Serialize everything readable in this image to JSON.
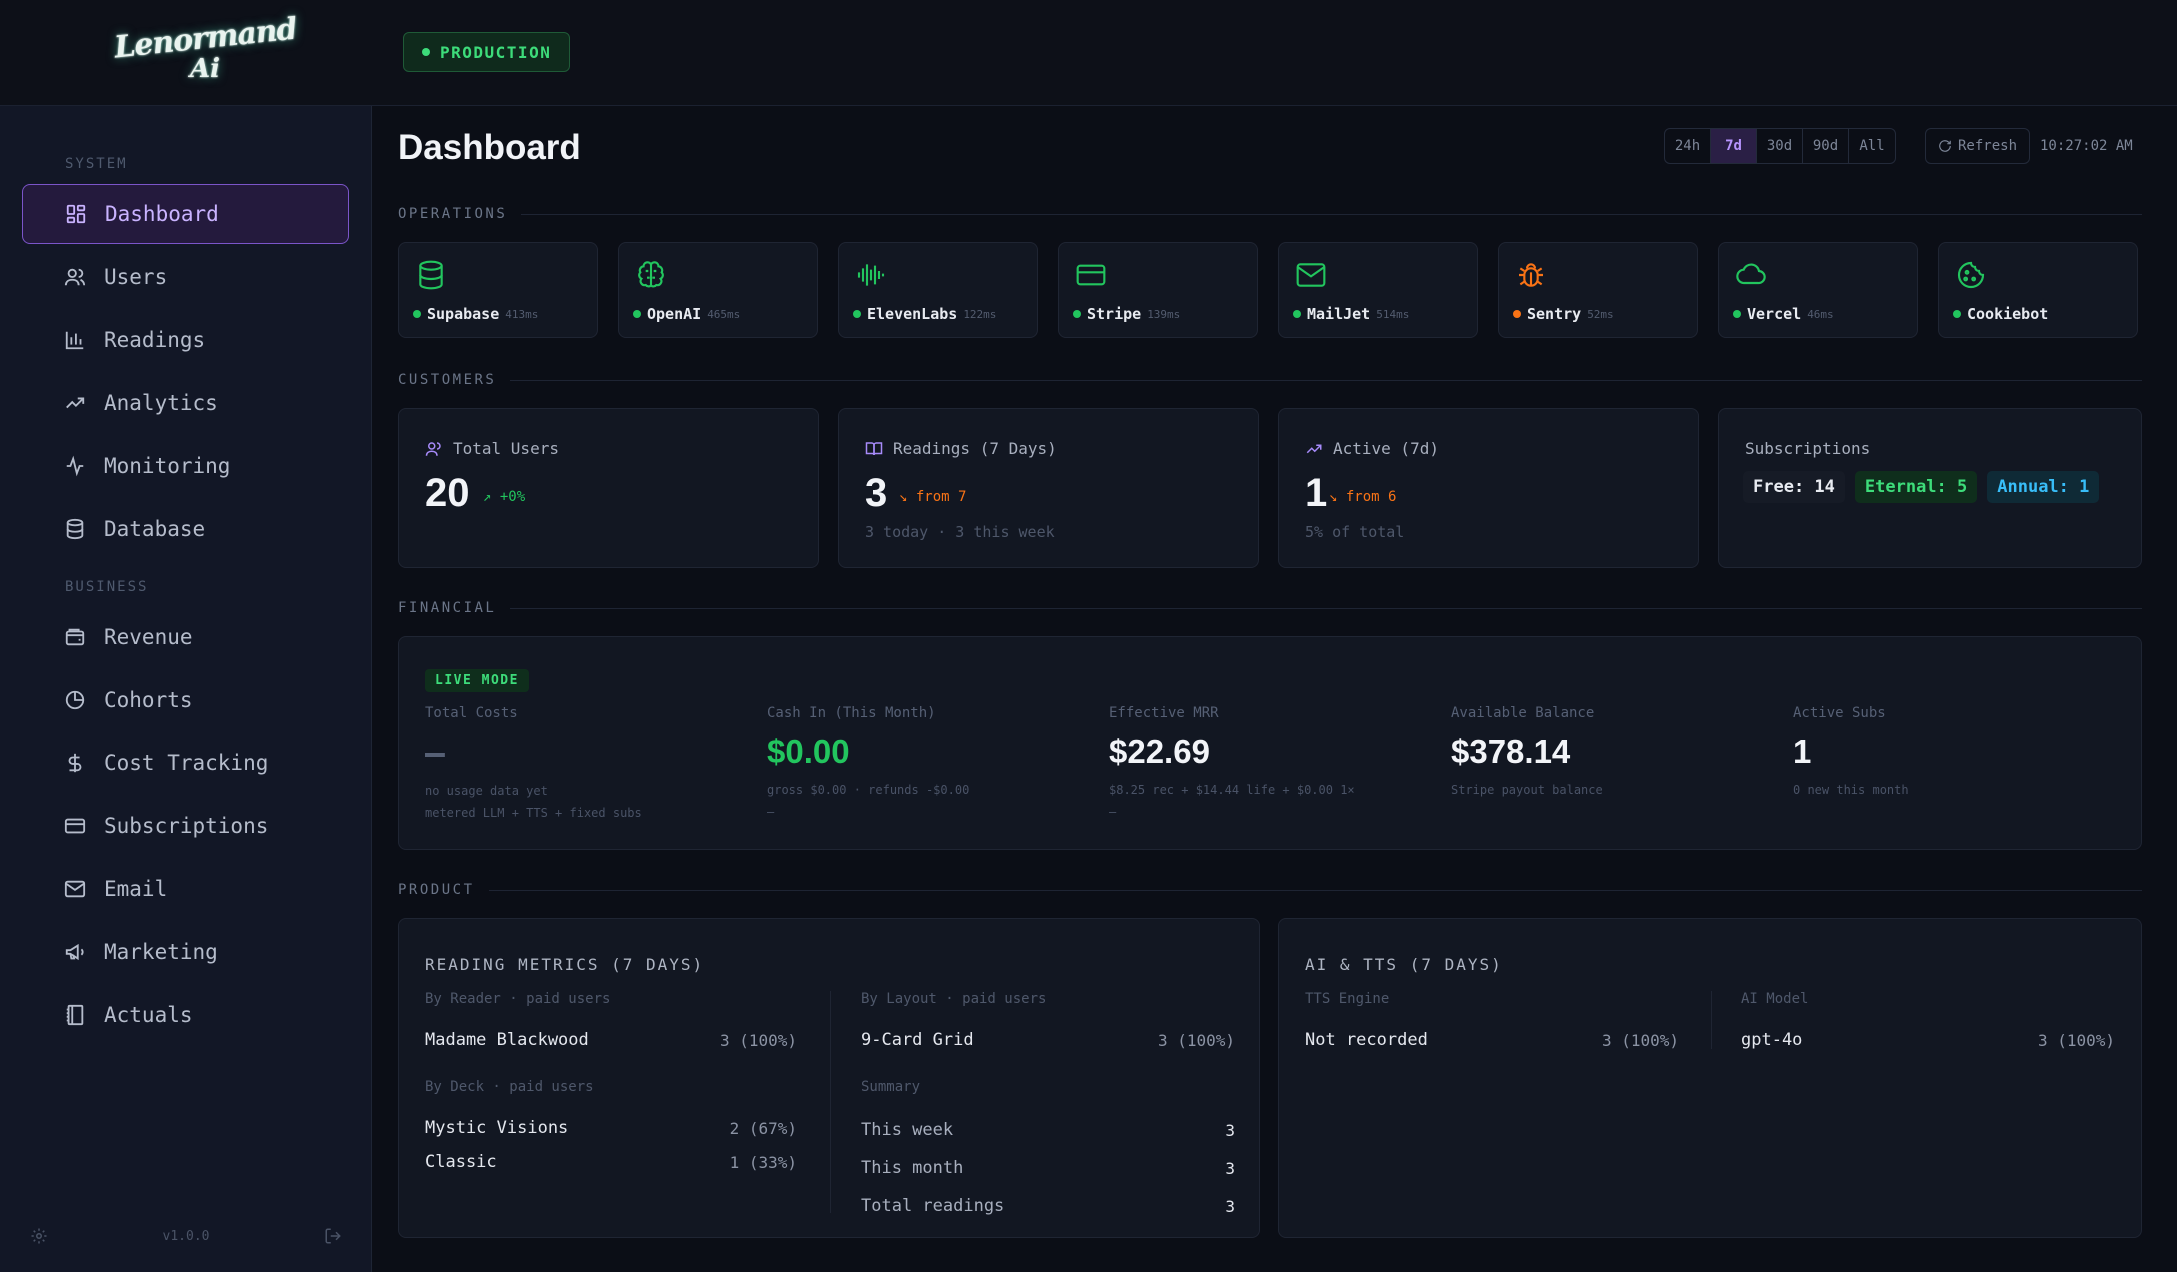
{
  "brand": {
    "logo_line1": "Lenormand",
    "logo_line2": "Ai"
  },
  "env": {
    "label": "PRODUCTION",
    "color": "#3ddc7a"
  },
  "sidebar": {
    "sections": [
      {
        "label": "SYSTEM"
      },
      {
        "label": "BUSINESS"
      }
    ],
    "items": [
      {
        "label": "Dashboard",
        "icon": "grid-icon",
        "active": true
      },
      {
        "label": "Users",
        "icon": "users-icon"
      },
      {
        "label": "Readings",
        "icon": "bar-chart-icon"
      },
      {
        "label": "Analytics",
        "icon": "trending-up-icon"
      },
      {
        "label": "Monitoring",
        "icon": "activity-icon"
      },
      {
        "label": "Database",
        "icon": "database-icon"
      },
      {
        "label": "Revenue",
        "icon": "wallet-icon"
      },
      {
        "label": "Cohorts",
        "icon": "pie-chart-icon"
      },
      {
        "label": "Cost Tracking",
        "icon": "dollar-icon"
      },
      {
        "label": "Subscriptions",
        "icon": "credit-card-icon"
      },
      {
        "label": "Email",
        "icon": "mail-icon"
      },
      {
        "label": "Marketing",
        "icon": "megaphone-icon"
      },
      {
        "label": "Actuals",
        "icon": "notebook-icon"
      }
    ],
    "version": "v1.0.0"
  },
  "header": {
    "title": "Dashboard",
    "ranges": [
      "24h",
      "7d",
      "30d",
      "90d",
      "All"
    ],
    "selected_range": "7d",
    "refresh_label": "Refresh",
    "clock": "10:27:02 AM"
  },
  "sections": {
    "operations": "OPERATIONS",
    "customers": "CUSTOMERS",
    "financial": "FINANCIAL",
    "product": "PRODUCT"
  },
  "services": [
    {
      "name": "Supabase",
      "ms": "413ms",
      "status": "#22c55e",
      "icon": "database-icon"
    },
    {
      "name": "OpenAI",
      "ms": "465ms",
      "status": "#22c55e",
      "icon": "brain-icon"
    },
    {
      "name": "ElevenLabs",
      "ms": "122ms",
      "status": "#22c55e",
      "icon": "audio-wave-icon"
    },
    {
      "name": "Stripe",
      "ms": "139ms",
      "status": "#22c55e",
      "icon": "credit-card-icon"
    },
    {
      "name": "MailJet",
      "ms": "514ms",
      "status": "#22c55e",
      "icon": "mail-icon"
    },
    {
      "name": "Sentry",
      "ms": "52ms",
      "status": "#f97316",
      "icon": "bug-icon"
    },
    {
      "name": "Vercel",
      "ms": "46ms",
      "status": "#22c55e",
      "icon": "cloud-icon"
    },
    {
      "name": "Cookiebot",
      "ms": "",
      "status": "#22c55e",
      "icon": "cookie-icon"
    }
  ],
  "customers": {
    "total_users": {
      "label": "Total Users",
      "value": "20",
      "delta": "↗ +0%"
    },
    "readings": {
      "label": "Readings (7 Days)",
      "value": "3",
      "delta": "↘ from 7",
      "sub": "3 today · 3 this week"
    },
    "active": {
      "label": "Active (7d)",
      "value": "1",
      "delta": "↘ from 6",
      "sub": "5% of total"
    },
    "subscriptions": {
      "label": "Subscriptions",
      "free": "Free: 14",
      "eternal": "Eternal: 5",
      "annual": "Annual: 1"
    }
  },
  "financial": {
    "mode": "LIVE MODE",
    "total_costs": {
      "label": "Total Costs",
      "value": "—",
      "s1": "no usage data yet",
      "s2": "metered LLM + TTS + fixed subs"
    },
    "cash_in": {
      "label": "Cash In (This Month)",
      "value": "$0.00",
      "s1": "gross $0.00 · refunds -$0.00",
      "s2": "—"
    },
    "mrr": {
      "label": "Effective MRR",
      "value": "$22.69",
      "s1": "$8.25 rec + $14.44 life + $0.00 1×",
      "s2": "—"
    },
    "balance": {
      "label": "Available Balance",
      "value": "$378.14",
      "s1": "Stripe payout balance"
    },
    "active_subs": {
      "label": "Active Subs",
      "value": "1",
      "s1": "0 new this month"
    }
  },
  "reading_metrics": {
    "title": "READING METRICS (7 DAYS)",
    "by_reader_label": "By Reader · paid users",
    "by_reader": [
      {
        "name": "Madame Blackwood",
        "value": "3 (100%)"
      }
    ],
    "by_deck_label": "By Deck · paid users",
    "by_deck": [
      {
        "name": "Mystic Visions",
        "value": "2 (67%)"
      },
      {
        "name": "Classic",
        "value": "1 (33%)"
      }
    ],
    "by_layout_label": "By Layout · paid users",
    "by_layout": [
      {
        "name": "9-Card Grid",
        "value": "3 (100%)"
      }
    ],
    "summary_label": "Summary",
    "summary": [
      {
        "name": "This week",
        "value": "3"
      },
      {
        "name": "This month",
        "value": "3"
      },
      {
        "name": "Total readings",
        "value": "3"
      }
    ]
  },
  "ai_tts": {
    "title": "AI & TTS (7 DAYS)",
    "tts_label": "TTS Engine",
    "tts": [
      {
        "name": "Not recorded",
        "value": "3 (100%)"
      }
    ],
    "model_label": "AI Model",
    "model": [
      {
        "name": "gpt-4o",
        "value": "3 (100%)"
      }
    ]
  }
}
